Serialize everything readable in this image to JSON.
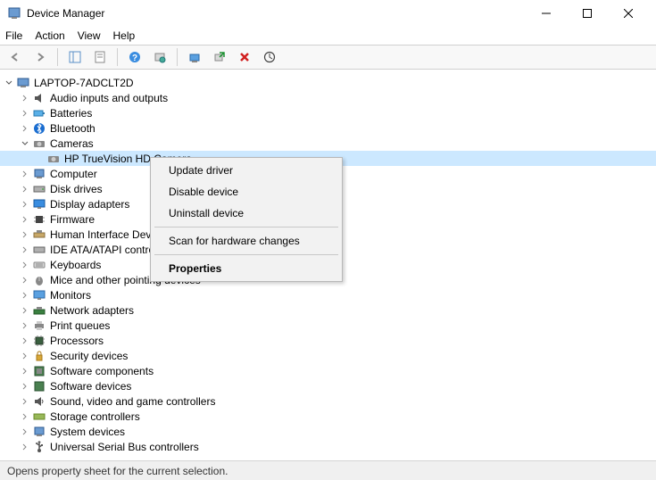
{
  "window": {
    "title": "Device Manager"
  },
  "menubar": {
    "file": "File",
    "action": "Action",
    "view": "View",
    "help": "Help"
  },
  "tree": {
    "root": "LAPTOP-7ADCLT2D",
    "audio": "Audio inputs and outputs",
    "batteries": "Batteries",
    "bluetooth": "Bluetooth",
    "cameras": "Cameras",
    "camera_device": "HP TrueVision HD Camera",
    "computer": "Computer",
    "disk": "Disk drives",
    "display": "Display adapters",
    "firmware": "Firmware",
    "hid": "Human Interface Dev",
    "ide": "IDE ATA/ATAPI control",
    "keyboards": "Keyboards",
    "mice": "Mice and other pointing devices",
    "monitors": "Monitors",
    "network": "Network adapters",
    "print": "Print queues",
    "processors": "Processors",
    "security": "Security devices",
    "softcomp": "Software components",
    "softdev": "Software devices",
    "sound": "Sound, video and game controllers",
    "storage": "Storage controllers",
    "system": "System devices",
    "usb": "Universal Serial Bus controllers"
  },
  "context_menu": {
    "update": "Update driver",
    "disable": "Disable device",
    "uninstall": "Uninstall device",
    "scan": "Scan for hardware changes",
    "properties": "Properties"
  },
  "statusbar": {
    "text": "Opens property sheet for the current selection."
  }
}
